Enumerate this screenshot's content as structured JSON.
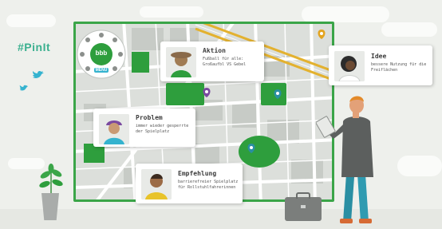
{
  "brand": {
    "hashtag": "#PinIt"
  },
  "menu": {
    "logo_text": "bbb",
    "badge": "MENÜ"
  },
  "cards": [
    {
      "id": "aktion",
      "title": "Aktion",
      "lines": [
        "Fußball für alle:",
        "Großaufbl VS Gebel"
      ]
    },
    {
      "id": "idee",
      "title": "Idee",
      "lines": [
        "bessere Nutzung für die",
        "Freiflächen"
      ]
    },
    {
      "id": "problem",
      "title": "Problem",
      "lines": [
        "immer wieder gesperrte",
        "der Spielplatz"
      ]
    },
    {
      "id": "empfehlung",
      "title": "Empfehlung",
      "lines": [
        "barrierefreier Spielplatz",
        "für Rollstuhlfahrerinnen"
      ]
    }
  ],
  "colors": {
    "board_border": "#3aa548",
    "park_green": "#2e9e3d",
    "road_yellow": "#e3b12f",
    "pin_green": "#3aa548",
    "pin_purple": "#7b4aa0",
    "pin_teal": "#2a8fa3",
    "pin_yellow": "#e3a41f",
    "hashtag": "#3bb08f",
    "bird": "#35b3cf"
  },
  "icons": [
    "twitter-bird-icon",
    "map-pin-icon",
    "menu-wheel-icon"
  ]
}
